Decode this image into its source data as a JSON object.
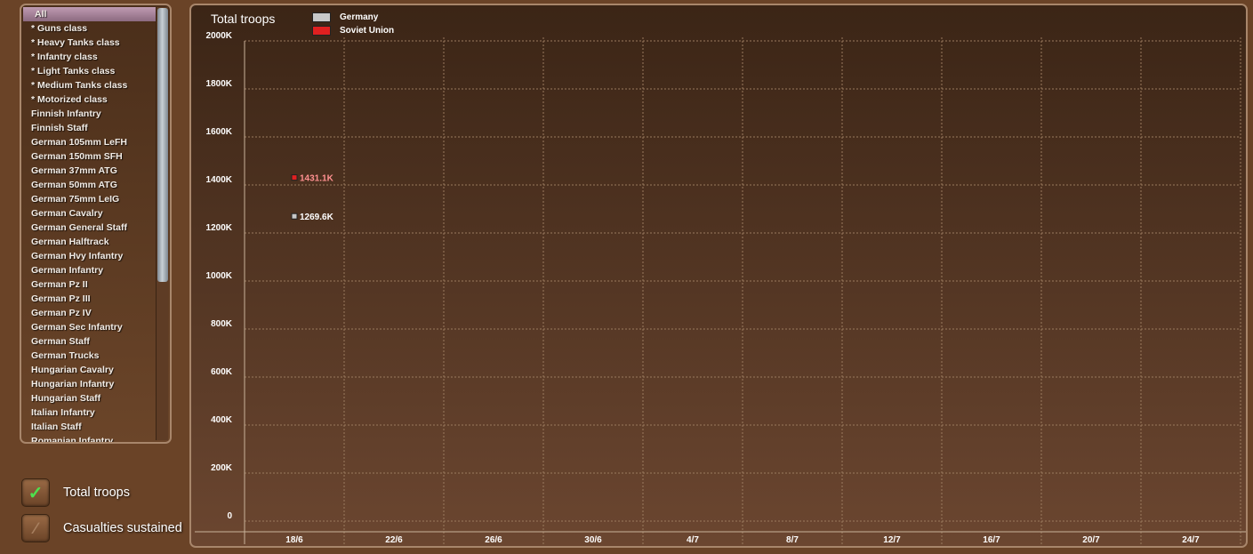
{
  "unit_list": {
    "selected_index": 0,
    "items": [
      "All",
      "* Guns class",
      "* Heavy Tanks class",
      "* Infantry class",
      "* Light Tanks class",
      "* Medium Tanks class",
      "* Motorized class",
      "Finnish Infantry",
      "Finnish Staff",
      "German 105mm LeFH",
      "German 150mm SFH",
      "German 37mm ATG",
      "German 50mm ATG",
      "German 75mm LeIG",
      "German Cavalry",
      "German General Staff",
      "German Halftrack",
      "German Hvy Infantry",
      "German Infantry",
      "German Pz II",
      "German Pz III",
      "German Pz IV",
      "German Sec Infantry",
      "German Staff",
      "German Trucks",
      "Hungarian Cavalry",
      "Hungarian Infantry",
      "Hungarian Staff",
      "Italian Infantry",
      "Italian Staff",
      "Romanian Infantry"
    ]
  },
  "toggles": {
    "total_troops": {
      "label": "Total troops",
      "checked": true
    },
    "casualties": {
      "label": "Casualties sustained",
      "checked": false
    }
  },
  "colors": {
    "germany": "#c8c8c8",
    "soviet": "#e02020",
    "grid": "#9a7a5e"
  },
  "chart_data": {
    "type": "scatter",
    "title": "Total troops",
    "xlabel": "",
    "ylabel": "",
    "ylim": [
      0,
      2000
    ],
    "y_tick_labels": [
      "0",
      "200K",
      "400K",
      "600K",
      "800K",
      "1000K",
      "1200K",
      "1400K",
      "1600K",
      "1800K",
      "2000K"
    ],
    "y_ticks": [
      0,
      200,
      400,
      600,
      800,
      1000,
      1200,
      1400,
      1600,
      1800,
      2000
    ],
    "categories": [
      "18/6",
      "22/6",
      "26/6",
      "30/6",
      "4/7",
      "8/7",
      "12/7",
      "16/7",
      "20/7",
      "24/7"
    ],
    "grid": true,
    "legend_position": "top-left",
    "series": [
      {
        "name": "Germany",
        "color": "#c8c8c8",
        "points": [
          {
            "x": "18/6",
            "y": 1269.6,
            "label": "1269.6K"
          }
        ]
      },
      {
        "name": "Soviet Union",
        "color": "#e02020",
        "points": [
          {
            "x": "18/6",
            "y": 1431.1,
            "label": "1431.1K"
          }
        ]
      }
    ]
  }
}
